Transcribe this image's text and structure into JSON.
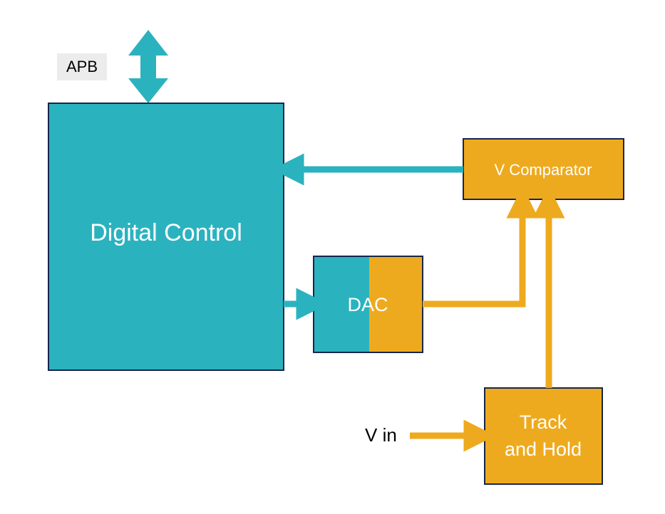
{
  "colors": {
    "teal": "#2bb2bf",
    "orange": "#eeaa1e",
    "darkOutline": "#17264a",
    "apbBg": "#ececec"
  },
  "blocks": {
    "digitalControl": {
      "label": "Digital Control"
    },
    "dac": {
      "label": "DAC"
    },
    "vComparator": {
      "label": "V Comparator"
    },
    "trackHold": {
      "line1": "Track",
      "line2": "and Hold"
    }
  },
  "labels": {
    "apb": "APB",
    "vin": "V in"
  }
}
